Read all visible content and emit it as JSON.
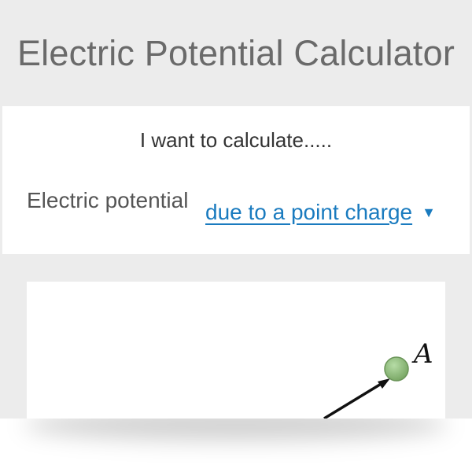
{
  "header": {
    "title": "Electric Potential Calculator"
  },
  "form": {
    "prompt": "I want to calculate.....",
    "field_label": "Electric potential",
    "selected_option": "due to a point charge",
    "caret": "▼"
  },
  "figure": {
    "point_label": "A",
    "point_color": "#8fbf7a",
    "arrow_color": "#111111"
  },
  "colors": {
    "background": "#ececec",
    "panel": "#ffffff",
    "title": "#6a6a6a",
    "link": "#1a7bbf"
  }
}
